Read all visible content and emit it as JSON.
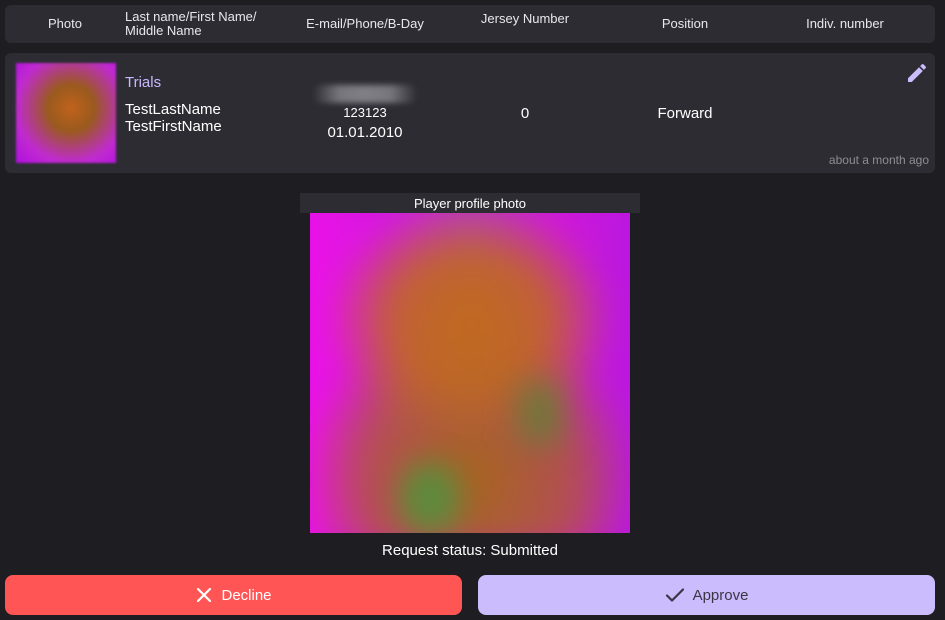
{
  "table_header": {
    "photo": "Photo",
    "name": "Last name/First Name/ Middle Name",
    "contacts": "E-mail/Phone/B-Day",
    "jersey": "Jersey Number",
    "position": "Position",
    "indiv": "Indiv. number"
  },
  "player": {
    "team": "Trials",
    "last_name": "TestLastName",
    "first_name": "TestFirstName",
    "phone": "123123",
    "birthday": "01.01.2010",
    "jersey_number": "0",
    "position": "Forward",
    "updated": "about a month ago"
  },
  "photo_caption": "Player profile photo",
  "request_status": "Request status: Submitted",
  "actions": {
    "decline_label": "Decline",
    "approve_label": "Approve"
  },
  "colors": {
    "accent": "#cbbcfd",
    "danger": "#ff5555",
    "team_link": "#c9b8ff",
    "surface": "#2d2c33",
    "background": "#1e1e22"
  },
  "icons": {
    "edit": "pencil-icon",
    "decline": "close-icon",
    "approve": "check-icon"
  }
}
